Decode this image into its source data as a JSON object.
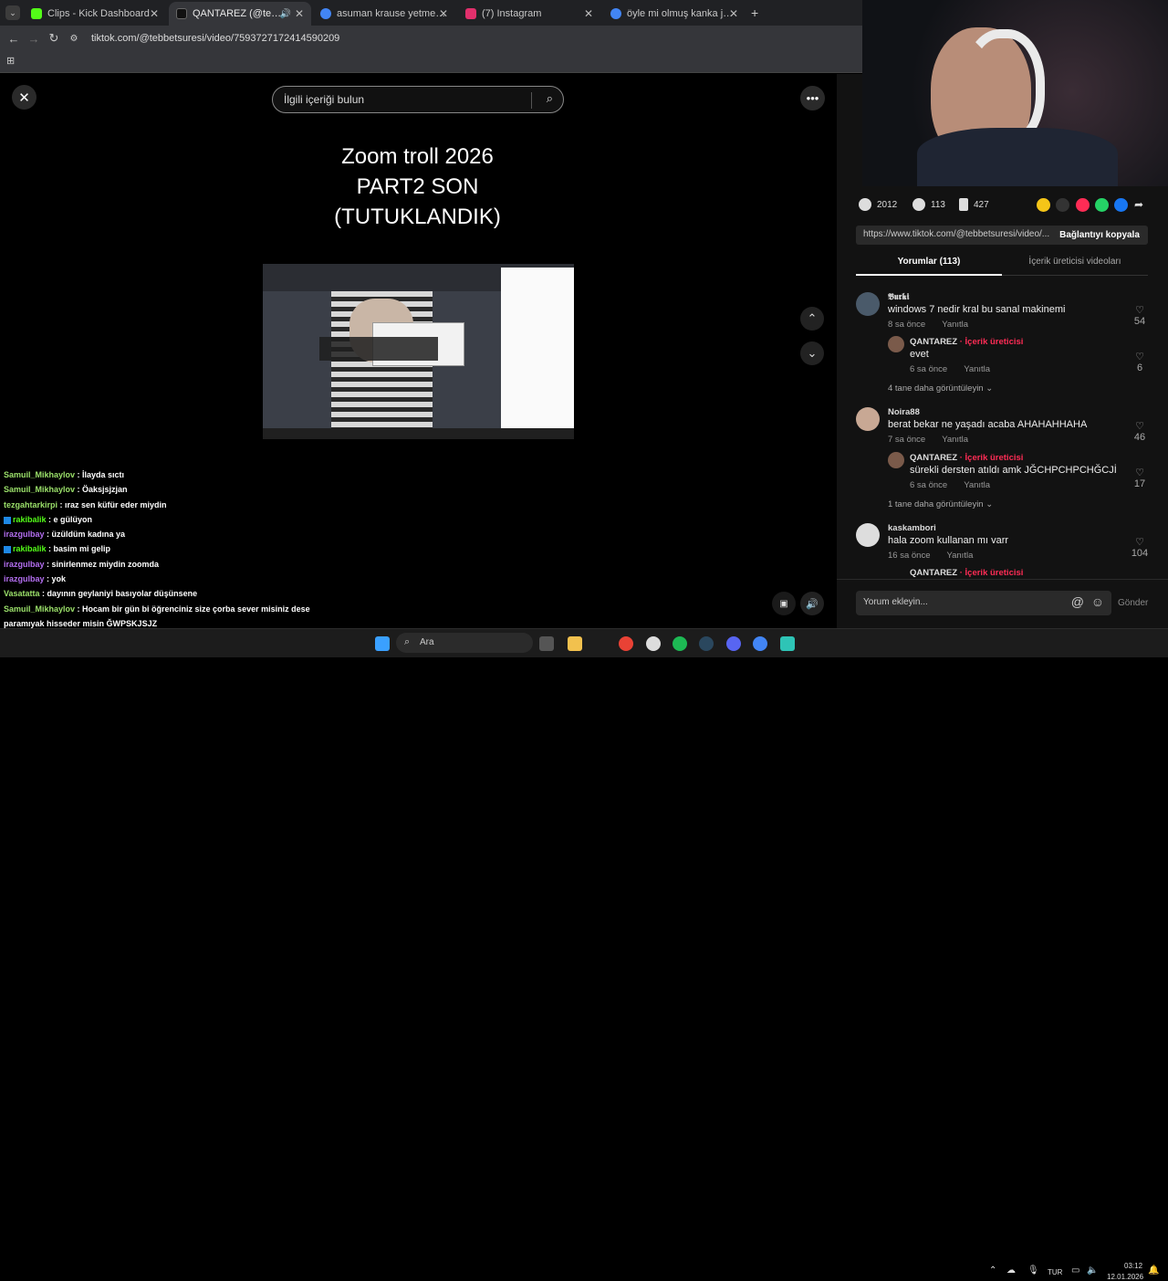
{
  "browser": {
    "tabs": [
      {
        "title": "Clips - Kick Dashboard",
        "color": "#53fc18"
      },
      {
        "title": "QANTAREZ (@tebbetsuresi)",
        "color": "#111111"
      },
      {
        "title": "asuman krause yetmez ama - G",
        "color": "#4285f4"
      },
      {
        "title": "(7) Instagram",
        "color": "#e1306c"
      },
      {
        "title": "öyle mi olmuş kanka jahrein - G",
        "color": "#4285f4"
      }
    ],
    "url": "tiktok.com/@tebbetsuresi/video/7593727172414590209"
  },
  "video": {
    "search_placeholder": "İlgili içeriği bulun",
    "title_lines": [
      "Zoom troll 2026",
      "PART2 SON",
      "(TUTUKLANDIK)"
    ]
  },
  "chat": [
    {
      "user": "Samuil_Mikhaylov",
      "msg": "İlayda sıctı",
      "color": "#9be06a"
    },
    {
      "user": "Samuil_Mikhaylov",
      "msg": "Öaksjsjzjan",
      "color": "#9be06a"
    },
    {
      "user": "tezgahtarkirpi",
      "msg": "ıraz sen küfür eder miydin",
      "color": "#9be06a"
    },
    {
      "user": "rakibalik",
      "msg": "e gülüyon",
      "color": "#53fc18",
      "badge": true
    },
    {
      "user": "irazgulbay",
      "msg": "üzüldüm kadına ya",
      "color": "#b36ef0"
    },
    {
      "user": "rakibalik",
      "msg": "basim mi gelip",
      "color": "#53fc18",
      "badge": true
    },
    {
      "user": "irazgulbay",
      "msg": "sinirlenmez miydin zoomda",
      "color": "#b36ef0"
    },
    {
      "user": "irazgulbay",
      "msg": "yok",
      "color": "#b36ef0"
    },
    {
      "user": "Vasatatta",
      "msg": "dayının geylaniyi basıyolar düşünsene",
      "color": "#9be06a"
    },
    {
      "user": "Samuil_Mikhaylov",
      "msg": "Hocam bir gün bi öğrenciniz size çorba sever misiniz dese",
      "color": "#9be06a"
    },
    {
      "user": "",
      "msg": "paramıyak hisseder misin ĞWPSKJSJZ",
      "color": "#9be06a"
    },
    {
      "user": "irazgulbay",
      "msg": "olm ben sinirlenirdim ya",
      "color": "#b36ef0"
    }
  ],
  "stats": {
    "likes": "2012",
    "comments": "113",
    "saves": "427"
  },
  "share": {
    "link": "https://www.tiktok.com/@tebbetsuresi/video/...",
    "copy_label": "Bağlantıyı kopyala"
  },
  "panel_tabs": {
    "comments": "Yorumlar (113)",
    "creator_videos": "İçerik üreticisi videoları"
  },
  "comments": [
    {
      "user": "𝕭𝖚𝖗𝖐𝖎",
      "text": "windows 7 nedir kral bu sanal makinemi",
      "time": "8 sa önce",
      "reply": "Yanıtla",
      "likes": "54",
      "sub": {
        "user": "QANTAREZ",
        "tag": "· İçerik üreticisi",
        "text": "evet",
        "time": "6 sa önce",
        "reply": "Yanıtla",
        "likes": "6"
      },
      "more": "4 tane daha görüntüleyin"
    },
    {
      "user": "Noira88",
      "text": "berat bekar ne yaşadı acaba AHAHAHHAHA",
      "time": "7 sa önce",
      "reply": "Yanıtla",
      "likes": "46",
      "sub": {
        "user": "QANTAREZ",
        "tag": "· İçerik üreticisi",
        "text": "sürekli dersten atıldı amk JĞCHPCHPCHĞCJİ",
        "time": "6 sa önce",
        "reply": "Yanıtla",
        "likes": "17"
      },
      "more": "1 tane daha görüntüleyin"
    },
    {
      "user": "kaskambori",
      "text": "hala zoom kullanan mı varr",
      "time": "16 sa önce",
      "reply": "Yanıtla",
      "likes": "104",
      "sub": {
        "user": "QANTAREZ",
        "tag": "· İçerik üreticisi"
      }
    }
  ],
  "comment_input": {
    "placeholder": "Yorum ekleyin...",
    "send": "Gönder"
  },
  "taskbar": {
    "search": "Ara",
    "lang": "TUR",
    "time": "03:12",
    "date": "12.01.2026"
  }
}
